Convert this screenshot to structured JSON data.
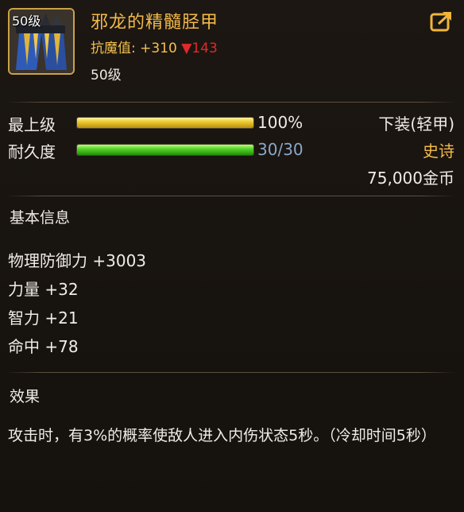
{
  "header": {
    "level_badge": "50级",
    "item_name": "邪龙的精髓胫甲",
    "resist_label": "抗魔值:",
    "resist_value": "+310",
    "resist_down": "▼143",
    "required_level": "50级"
  },
  "stats": {
    "upgrade": {
      "label": "最上级",
      "value_text": "100%",
      "fill": 1.0
    },
    "durability": {
      "label": "耐久度",
      "value_text": "30/30",
      "fill": 1.0
    }
  },
  "item_info": {
    "slot": "下装(轻甲)",
    "rarity": "史诗",
    "price": "75,000金币"
  },
  "basic_info": {
    "title": "基本信息",
    "attributes": [
      "物理防御力 +3003",
      "力量 +32",
      "智力 +21",
      "命中 +78"
    ]
  },
  "effect": {
    "title": "效果",
    "text": "攻击时，有3%的概率使敌人进入内伤状态5秒。（冷却时间5秒）"
  },
  "colors": {
    "name_gold": "#f3b94a",
    "resist_down_red": "#e2282b",
    "durability_blue": "#8aa7c9"
  },
  "icons": {
    "item": "armor-greaves-icon",
    "share": "share-icon"
  }
}
